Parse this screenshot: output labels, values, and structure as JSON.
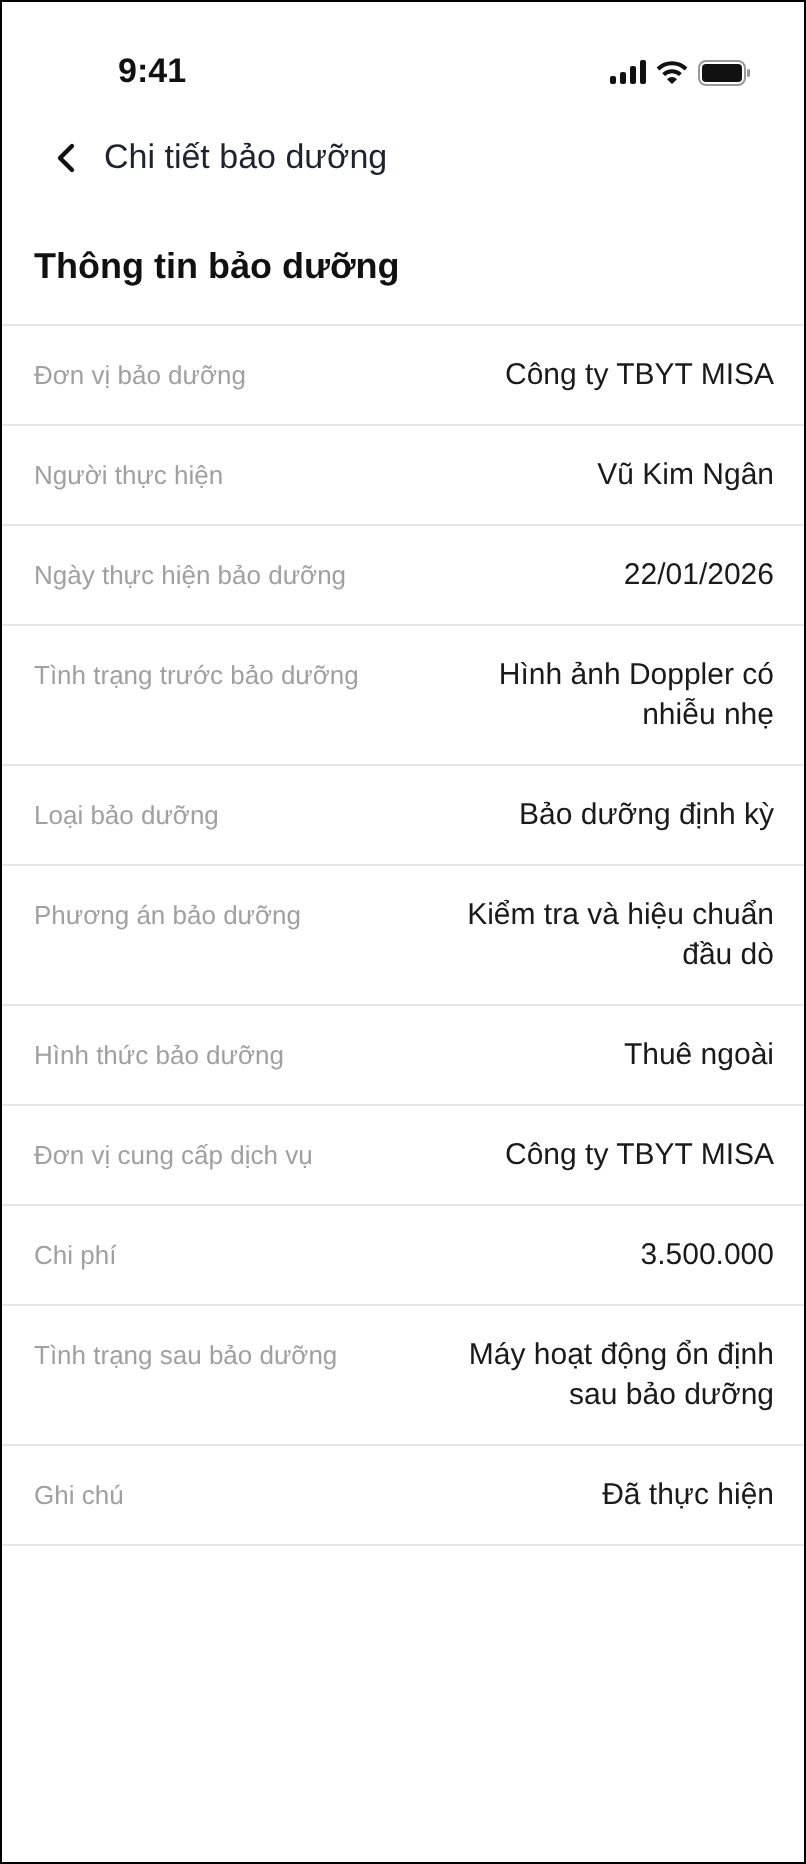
{
  "status_bar": {
    "time": "9:41"
  },
  "header": {
    "title": "Chi tiết bảo dưỡng"
  },
  "section": {
    "title": "Thông tin bảo dưỡng",
    "rows": [
      {
        "label": "Đơn vị bảo dưỡng",
        "value": "Công ty TBYT MISA"
      },
      {
        "label": "Người thực hiện",
        "value": "Vũ Kim Ngân"
      },
      {
        "label": "Ngày thực hiện bảo dưỡng",
        "value": "22/01/2026"
      },
      {
        "label": "Tình trạng trước bảo dưỡng",
        "value": "Hình ảnh Doppler có nhiễu nhẹ"
      },
      {
        "label": "Loại bảo dưỡng",
        "value": "Bảo dưỡng định kỳ"
      },
      {
        "label": "Phương án bảo dưỡng",
        "value": "Kiểm tra và hiệu chuẩn đầu dò"
      },
      {
        "label": "Hình thức bảo dưỡng",
        "value": "Thuê ngoài"
      },
      {
        "label": "Đơn vị cung cấp dịch vụ",
        "value": "Công ty TBYT MISA"
      },
      {
        "label": "Chi phí",
        "value": "3.500.000"
      },
      {
        "label": "Tình trạng sau bảo dưỡng",
        "value": "Máy hoạt động ổn định sau bảo dưỡng"
      },
      {
        "label": "Ghi chú",
        "value": "Đã thực hiện"
      }
    ]
  }
}
